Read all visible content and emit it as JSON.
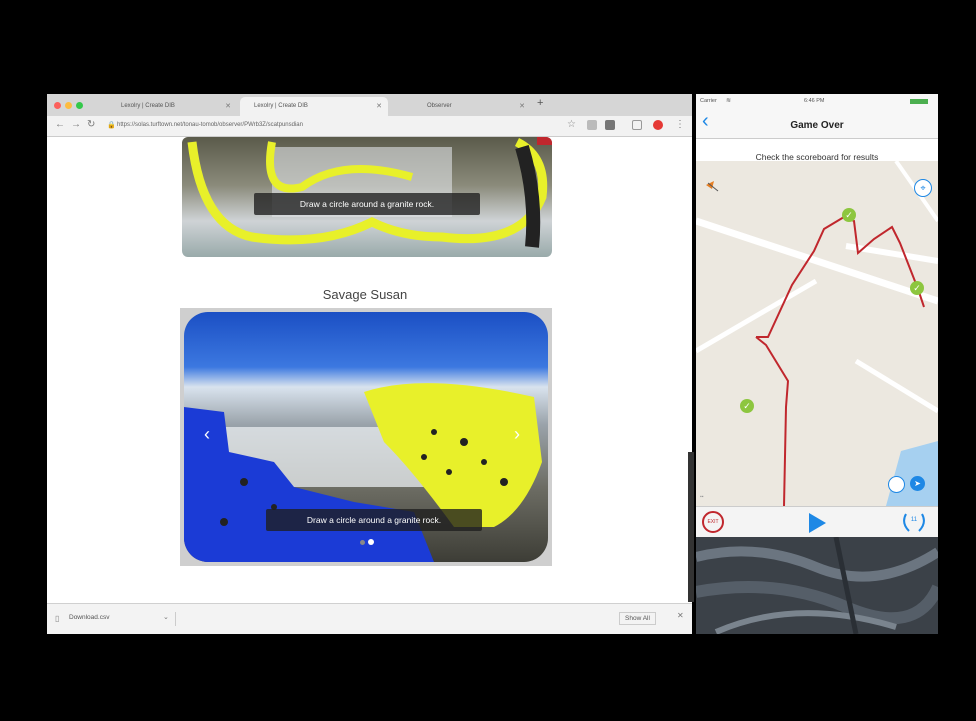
{
  "browser": {
    "tabs": [
      {
        "label": "Lexolry | Create DIB"
      },
      {
        "label": "Lexolry | Create DIB"
      },
      {
        "label": "Observer"
      }
    ],
    "url": "https://solas.turftown.net/tonau-tomob/observer/PWrb3Z/scatpunsdian",
    "page": {
      "caption_top": "Draw a circle around a granite rock.",
      "heading": "Savage Susan",
      "caption_bottom": "Draw a circle around a granite rock."
    },
    "download": {
      "filename": "Download.csv",
      "show_all": "Show All"
    }
  },
  "phone": {
    "status": {
      "carrier": "Carrier",
      "time": "6:46 PM"
    },
    "nav": {
      "title": "Game Over",
      "subtitle": "Check the scoreboard for results"
    },
    "toolbar": {
      "left_badge": "EXIT",
      "right_badge": "11"
    }
  },
  "colors": {
    "route": "#c0272d",
    "marker": "#8dc63f",
    "play": "#1e88e5",
    "highlighter": "#e8f02a",
    "blue_paint": "#1b3bd6"
  }
}
